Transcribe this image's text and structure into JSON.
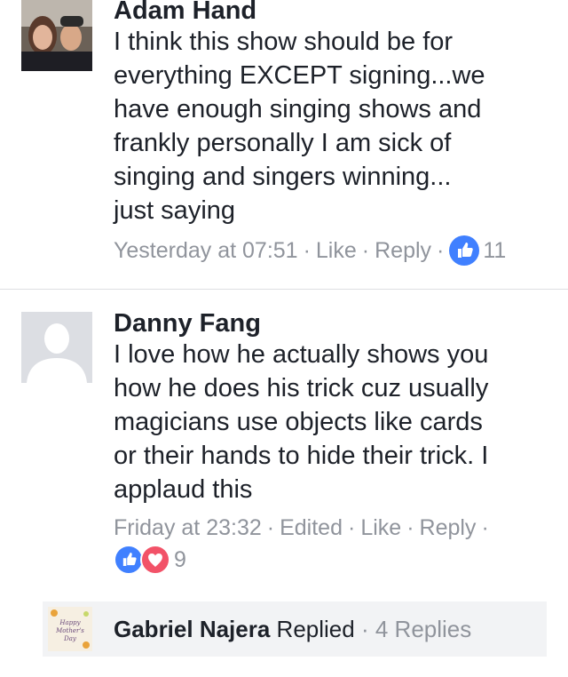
{
  "comments": [
    {
      "author": "Adam Hand",
      "text": "I think this show should be for\neverything EXCEPT signing...we\nhave enough singing shows and\nfrankly personally I am sick of\nsinging and singers winning...\njust saying",
      "time": "Yesterday at 07:51",
      "like_label": "Like",
      "reply_label": "Reply",
      "reaction_count": "11",
      "reactions": [
        "like"
      ]
    },
    {
      "author": "Danny Fang",
      "text": "I love how he actually shows you\nhow he does his trick cuz usually\nmagicians use objects like cards\nor their hands to hide their trick. I\napplaud this",
      "time": "Friday at 23:32",
      "edited_label": "Edited",
      "like_label": "Like",
      "reply_label": "Reply",
      "reaction_count": "9",
      "reactions": [
        "like",
        "love"
      ]
    }
  ],
  "reply_thread": {
    "name": "Gabriel Najera",
    "verb": "Replied",
    "count_label": "4 Replies",
    "thumb_text": "Happy Mother's Day"
  },
  "colors": {
    "like_blue": "#4080ff",
    "love_red": "#f25268",
    "meta_gray": "#90949c"
  }
}
